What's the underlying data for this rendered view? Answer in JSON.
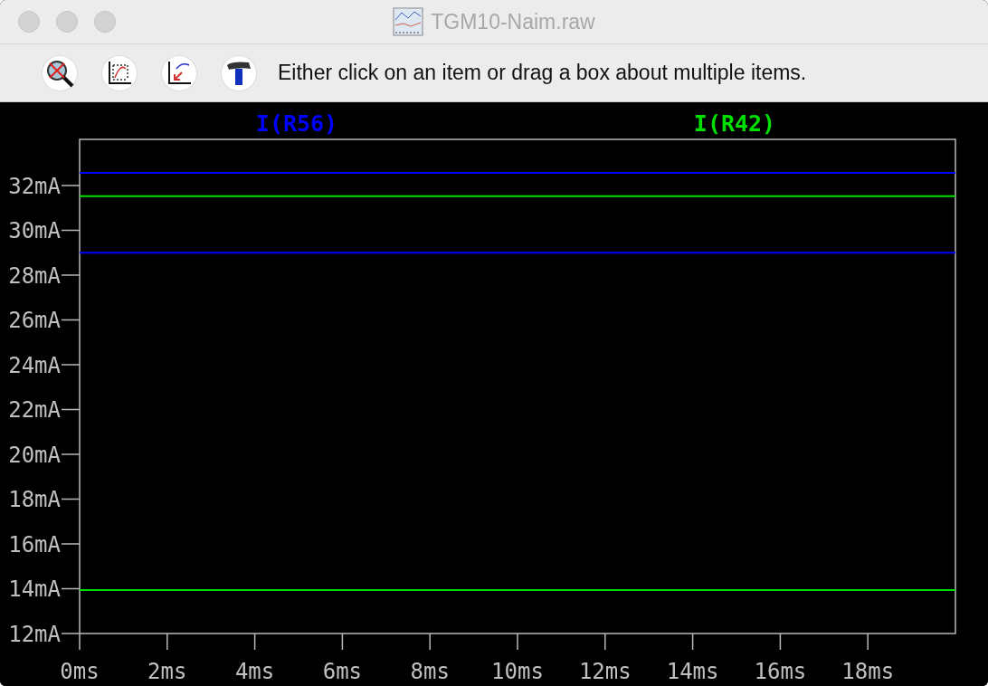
{
  "window": {
    "title": "TGM10-Naim.raw"
  },
  "toolbar": {
    "tools": [
      {
        "kind": "zoom-cancel"
      },
      {
        "kind": "autorange"
      },
      {
        "kind": "pan-back"
      },
      {
        "kind": "hammer"
      }
    ],
    "hint": "Either click on an item or drag a box about multiple items."
  },
  "plot": {
    "chart_data": {
      "type": "line",
      "x": [
        0,
        20
      ],
      "xlim": [
        0,
        20
      ],
      "ylim": [
        12,
        34.06
      ],
      "xticks": [
        {
          "value": 0,
          "label": "0ms"
        },
        {
          "value": 2,
          "label": "2ms"
        },
        {
          "value": 4,
          "label": "4ms"
        },
        {
          "value": 6,
          "label": "6ms"
        },
        {
          "value": 8,
          "label": "8ms"
        },
        {
          "value": 10,
          "label": "10ms"
        },
        {
          "value": 12,
          "label": "12ms"
        },
        {
          "value": 14,
          "label": "14ms"
        },
        {
          "value": 16,
          "label": "16ms"
        },
        {
          "value": 18,
          "label": "18ms"
        }
      ],
      "yticks": [
        {
          "value": 12,
          "label": "12mA"
        },
        {
          "value": 14,
          "label": "14mA"
        },
        {
          "value": 16,
          "label": "16mA"
        },
        {
          "value": 18,
          "label": "18mA"
        },
        {
          "value": 20,
          "label": "20mA"
        },
        {
          "value": 22,
          "label": "22mA"
        },
        {
          "value": 24,
          "label": "24mA"
        },
        {
          "value": 26,
          "label": "26mA"
        },
        {
          "value": 28,
          "label": "28mA"
        },
        {
          "value": 30,
          "label": "30mA"
        },
        {
          "value": 32,
          "label": "32mA"
        }
      ],
      "series": [
        {
          "name": "I(R56)",
          "color": "#0000ff",
          "values": [
            32.57,
            32.57
          ]
        },
        {
          "name": "I(R42)",
          "color": "#00e000",
          "values": [
            31.52,
            31.52
          ]
        },
        {
          "color": "#0000ff",
          "values": [
            29.0,
            29.0
          ]
        },
        {
          "color": "#00e000",
          "values": [
            13.94,
            13.94
          ]
        }
      ]
    }
  }
}
